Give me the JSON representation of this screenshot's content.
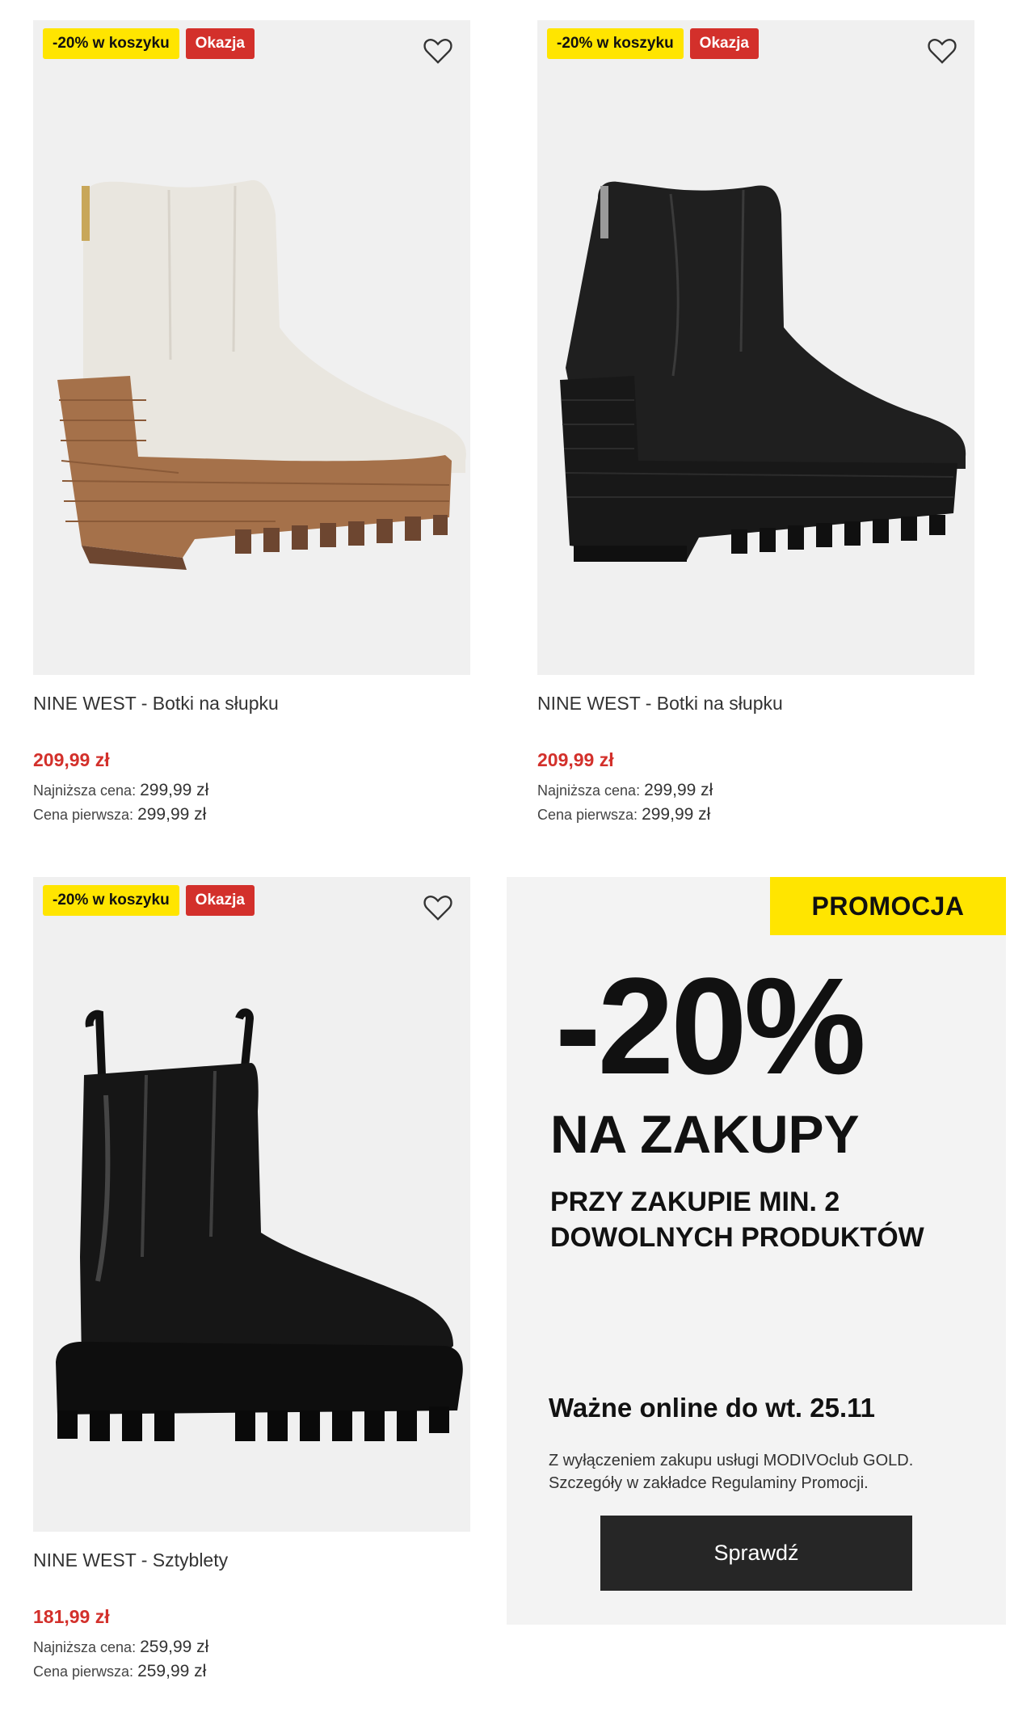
{
  "products": [
    {
      "badge_discount": "-20% w koszyku",
      "badge_deal": "Okazja",
      "title": "NINE WEST - Botki na słupku",
      "price": "209,99 zł",
      "lowest_label": "Najniższa cena:",
      "lowest_value": "299,99 zł",
      "original_label": "Cena pierwsza:",
      "original_value": "299,99 zł",
      "image_icon": "white-heeled-chelsea-boot"
    },
    {
      "badge_discount": "-20% w koszyku",
      "badge_deal": "Okazja",
      "title": "NINE WEST - Botki na słupku",
      "price": "209,99 zł",
      "lowest_label": "Najniższa cena:",
      "lowest_value": "299,99 zł",
      "original_label": "Cena pierwsza:",
      "original_value": "299,99 zł",
      "image_icon": "black-heeled-chelsea-boot"
    },
    {
      "badge_discount": "-20% w koszyku",
      "badge_deal": "Okazja",
      "title": "NINE WEST - Sztyblety",
      "price": "181,99 zł",
      "lowest_label": "Najniższa cena:",
      "lowest_value": "259,99 zł",
      "original_label": "Cena pierwsza:",
      "original_value": "259,99 zł",
      "image_icon": "black-patent-chelsea-boot"
    }
  ],
  "promo": {
    "tag": "PROMOCJA",
    "discount": "-20%",
    "headline": "NA ZAKUPY",
    "subline": "PRZY ZAKUPIE MIN. 2 DOWOLNYCH PRODUKTÓW",
    "validity": "Ważne online do wt. 25.11",
    "note": "Z wyłączeniem zakupu usługi MODIVOclub GOLD. Szczegóły w zakładce Regulaminy Promocji.",
    "button": "Sprawdź"
  },
  "colors": {
    "accent_yellow": "#ffe500",
    "sale_red": "#d3302b",
    "button_dark": "#262626",
    "card_bg": "#f0f0f0"
  },
  "icons": {
    "favorite": "heart-outline-icon"
  }
}
